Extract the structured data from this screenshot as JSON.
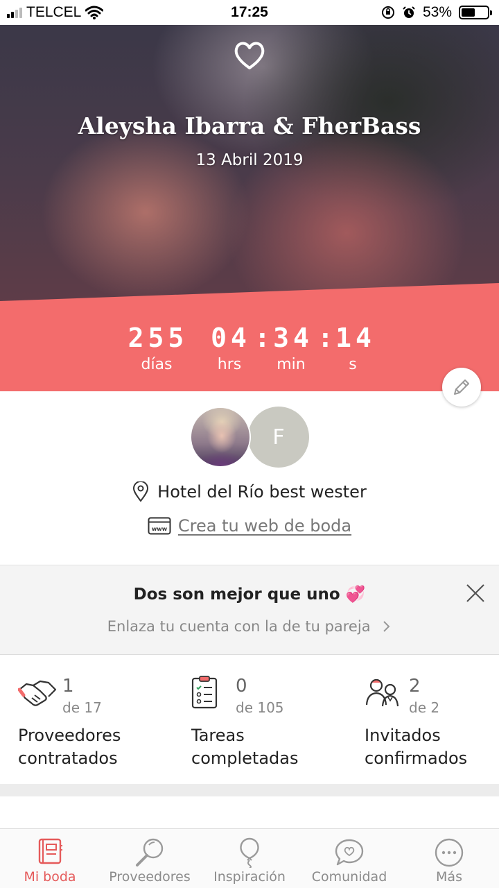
{
  "status_bar": {
    "carrier": "TELCEL",
    "time": "17:25",
    "battery_percent": "53%",
    "battery_level": 0.53
  },
  "hero": {
    "couple_names": "Aleysha Ibarra & FherBass",
    "wedding_date": "13 Abril 2019",
    "countdown": {
      "days": "255",
      "hours": "04",
      "minutes": "34",
      "seconds": "14",
      "days_label": "días",
      "hours_label": "hrs",
      "minutes_label": "min",
      "seconds_label": "s"
    },
    "accent_color": "#f36c6c"
  },
  "partners": {
    "second_initial": "F"
  },
  "venue": {
    "name": "Hotel del Río best wester",
    "web_link": "Crea tu web de boda"
  },
  "promo": {
    "title": "Dos son mejor que uno 💞",
    "link": "Enlaza tu cuenta con la de tu pareja"
  },
  "stats": [
    {
      "icon": "handshake-icon",
      "count": "1",
      "of": "de 17",
      "label_line1": "Proveedores",
      "label_line2": "contratados"
    },
    {
      "icon": "checklist-icon",
      "count": "0",
      "of": "de 105",
      "label_line1": "Tareas",
      "label_line2": "completadas"
    },
    {
      "icon": "guests-icon",
      "count": "2",
      "of": "de 2",
      "label_line1": "Invitados",
      "label_line2": "confirmados"
    }
  ],
  "tabs": [
    {
      "label": "Mi boda",
      "icon": "notebook-icon",
      "active": true
    },
    {
      "label": "Proveedores",
      "icon": "magnifier-icon",
      "active": false
    },
    {
      "label": "Inspiración",
      "icon": "balloon-icon",
      "active": false
    },
    {
      "label": "Comunidad",
      "icon": "chat-heart-icon",
      "active": false
    },
    {
      "label": "Más",
      "icon": "more-icon",
      "active": false
    }
  ]
}
